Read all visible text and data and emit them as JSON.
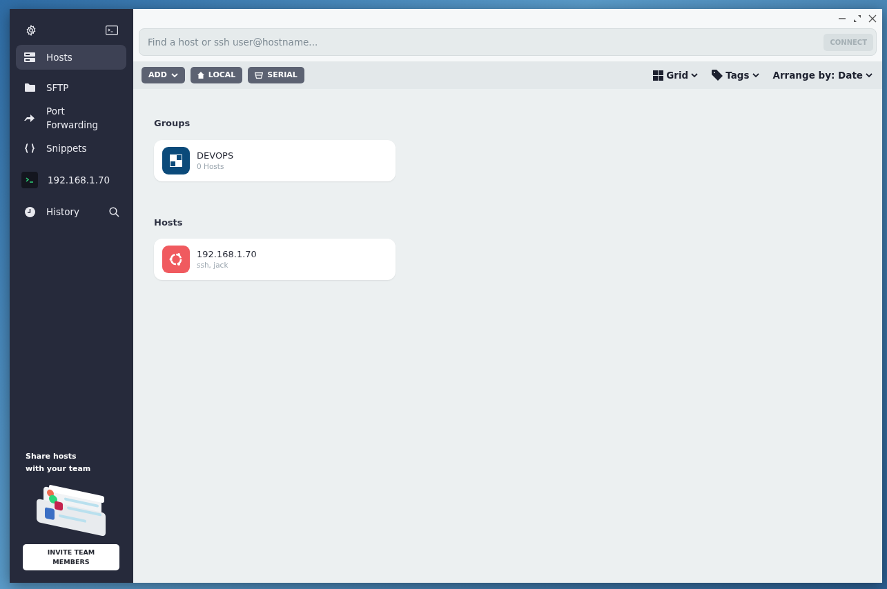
{
  "sidebar": {
    "items": [
      {
        "label": "Hosts",
        "selected": true,
        "kind": "nav"
      },
      {
        "label": "SFTP",
        "selected": false,
        "kind": "nav"
      },
      {
        "label": "Port Forwarding",
        "selected": false,
        "kind": "nav"
      },
      {
        "label": "Snippets",
        "selected": false,
        "kind": "nav"
      },
      {
        "label": "192.168.1.70",
        "selected": false,
        "kind": "session"
      },
      {
        "label": "History",
        "selected": false,
        "kind": "history"
      }
    ],
    "promo": {
      "text": "Share hosts with your team",
      "button": "INVITE TEAM MEMBERS"
    }
  },
  "search": {
    "placeholder": "Find a host or ssh user@hostname...",
    "button": "CONNECT",
    "disabled": true
  },
  "toolbar": {
    "buttons": [
      {
        "label": "ADD",
        "kind": "dropdown"
      },
      {
        "label": "LOCAL",
        "kind": "local"
      },
      {
        "label": "SERIAL",
        "kind": "serial"
      }
    ],
    "view": [
      {
        "label": "Grid",
        "kind": "grid"
      },
      {
        "label": "Tags",
        "kind": "tags"
      },
      {
        "label": "Arrange by: Date",
        "kind": "sort"
      }
    ]
  },
  "sections": [
    {
      "title": "Groups",
      "cards": [
        {
          "kind": "group",
          "title": "DEVOPS",
          "subtitle": "0 Hosts",
          "color": "#0b4a7a"
        }
      ]
    },
    {
      "title": "Hosts",
      "cards": [
        {
          "kind": "host",
          "title": "192.168.1.70",
          "subtitle": "ssh, jack",
          "color": "#f05a5f"
        }
      ]
    }
  ]
}
